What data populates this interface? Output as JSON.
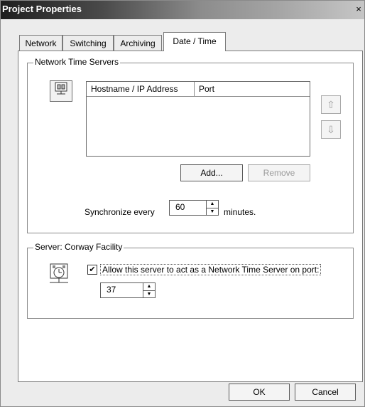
{
  "window": {
    "title": "Project Properties",
    "close": "×"
  },
  "tabs": [
    {
      "label": "Network"
    },
    {
      "label": "Switching"
    },
    {
      "label": "Archiving"
    },
    {
      "label": "Date / Time",
      "active": true
    }
  ],
  "time_servers": {
    "legend": "Network Time Servers",
    "icon": "network-server-icon",
    "columns": [
      "Hostname / IP Address",
      "Port"
    ],
    "rows": [],
    "move_up_icon": "⇧",
    "move_down_icon": "⇩",
    "add_label": "Add...",
    "remove_label": "Remove",
    "sync_prefix": "Synchronize every",
    "sync_value": "60",
    "sync_suffix": "minutes."
  },
  "server": {
    "legend": "Server: Corway Facility",
    "icon": "clock-server-icon",
    "checkbox_checked": true,
    "checkbox_label": "Allow this server to act as a Network Time Server on port:",
    "port_value": "37"
  },
  "footer": {
    "ok_label": "OK",
    "cancel_label": "Cancel"
  }
}
